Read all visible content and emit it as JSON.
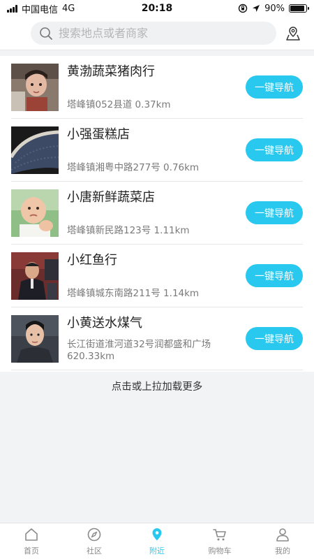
{
  "status": {
    "carrier": "中国电信",
    "network": "4G",
    "time": "20:18",
    "battery": "90%",
    "battery_level": 0.9
  },
  "search": {
    "placeholder": "搜索地点或者商家"
  },
  "stores": [
    {
      "name": "黄渤蔬菜猪肉行",
      "address": "塔峰镇052县道 0.37km",
      "button": "一键导航"
    },
    {
      "name": "小强蛋糕店",
      "address": "塔峰镇湘粤中路277号 0.76km",
      "button": "一键导航"
    },
    {
      "name": "小唐新鲜蔬菜店",
      "address": "塔峰镇新民路123号 1.11km",
      "button": "一键导航"
    },
    {
      "name": "小红鱼行",
      "address": "塔峰镇城东南路211号 1.14km",
      "button": "一键导航"
    },
    {
      "name": "小黄送水煤气",
      "address": "长江街道淮河道32号润都盛和广场 620.33km",
      "button": "一键导航"
    }
  ],
  "load_more": "点击或上拉加载更多",
  "tabs": [
    {
      "label": "首页",
      "icon": "home-icon"
    },
    {
      "label": "社区",
      "icon": "compass-icon"
    },
    {
      "label": "附近",
      "icon": "location-pin-icon"
    },
    {
      "label": "购物车",
      "icon": "cart-icon"
    },
    {
      "label": "我的",
      "icon": "person-icon"
    }
  ],
  "colors": {
    "accent": "#28c8ef",
    "background": "#f2f3f5"
  }
}
